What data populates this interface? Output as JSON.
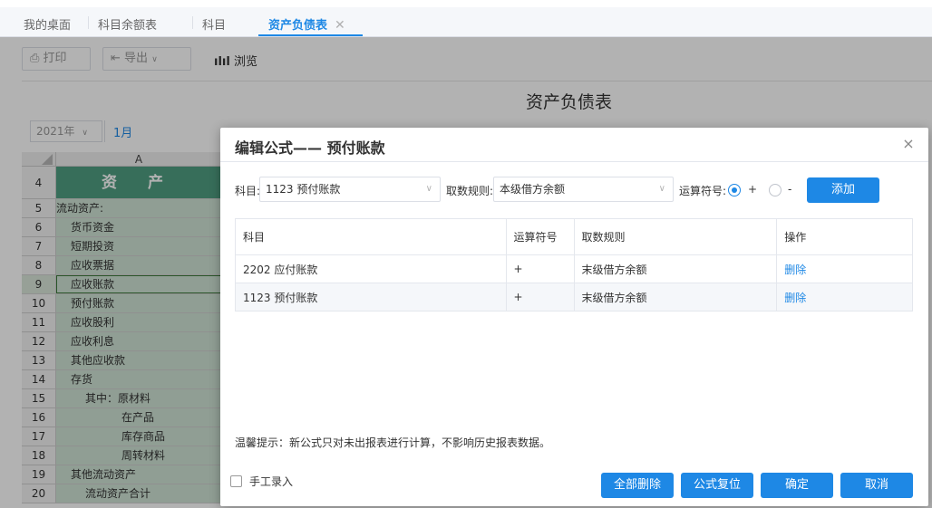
{
  "tabs": [
    {
      "label": "我的桌面"
    },
    {
      "label": "科目余额表"
    },
    {
      "label": "科目"
    },
    {
      "label": "资产负债表",
      "close": "✕"
    }
  ],
  "toolbar": {
    "print_label": "打印",
    "export_label": "导出",
    "preview_label": "浏览"
  },
  "report": {
    "title": "资产负债表",
    "year": "2021年",
    "month": "1月"
  },
  "sheet": {
    "column_letter": "A",
    "rows": [
      {
        "num": "4",
        "text": "资 产"
      },
      {
        "num": "5",
        "text": "流动资产:"
      },
      {
        "num": "6",
        "text": "货币资金"
      },
      {
        "num": "7",
        "text": "短期投资"
      },
      {
        "num": "8",
        "text": "应收票据"
      },
      {
        "num": "9",
        "text": "应收账款"
      },
      {
        "num": "10",
        "text": "预付账款"
      },
      {
        "num": "11",
        "text": "应收股利"
      },
      {
        "num": "12",
        "text": "应收利息"
      },
      {
        "num": "13",
        "text": "其他应收款"
      },
      {
        "num": "14",
        "text": "存货"
      },
      {
        "num": "15",
        "text": "其中：原材料"
      },
      {
        "num": "16",
        "text": "在产品"
      },
      {
        "num": "17",
        "text": "库存商品"
      },
      {
        "num": "18",
        "text": "周转材料"
      },
      {
        "num": "19",
        "text": "其他流动资产"
      },
      {
        "num": "20",
        "text": "流动资产合计"
      }
    ]
  },
  "dialog": {
    "title": "编辑公式—— 预付账款",
    "close": "×",
    "subject_label": "科目:",
    "subject_value": "1123 预付账款",
    "rule_label": "取数规则:",
    "rule_value": "本级借方余额",
    "operator_label": "运算符号:",
    "operator_plus": "+",
    "operator_minus": "-",
    "add_button": "添加",
    "table": {
      "headers": [
        "科目",
        "运算符号",
        "取数规则",
        "操作"
      ],
      "rows": [
        {
          "subject": "2202 应付账款",
          "op": "+",
          "rule": "末级借方余额",
          "action": "删除"
        },
        {
          "subject": "1123 预付账款",
          "op": "+",
          "rule": "末级借方余额",
          "action": "删除"
        }
      ]
    },
    "tip": "温馨提示：新公式只对未出报表进行计算，不影响历史报表数据。",
    "manual_entry_label": "手工录入",
    "buttons": {
      "delete_all": "全部删除",
      "reset": "公式复位",
      "confirm": "确定",
      "cancel": "取消"
    }
  }
}
